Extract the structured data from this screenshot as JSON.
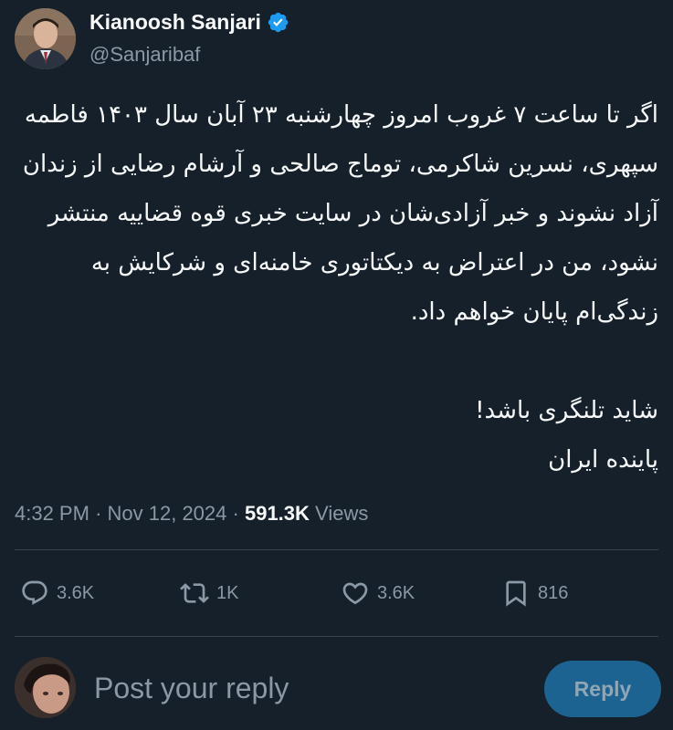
{
  "author": {
    "name": "Kianoosh Sanjari",
    "handle": "@Sanjaribaf"
  },
  "tweet": {
    "paragraph1": "اگر تا ساعت ۷ غروب امروز چهارشنبه ۲۳ آبان سال ۱۴۰۳ فاطمه سپهری، نسرین شاکرمی، توماج صالحی و آرشام رضایی از زندان آزاد نشوند و خبر آزادی‌شان در سایت خبری قوه قضاییه منتشر نشود، من در اعتراض به دیکتاتوری خامنه‌ای و شرکایش به زندگی‌ام پایان خواهم داد.",
    "line2": "شاید تلنگری باشد!",
    "line3": "پاینده ایران"
  },
  "meta": {
    "time": "4:32 PM",
    "separator1": "·",
    "date": "Nov 12, 2024",
    "separator2": "·",
    "views_count": "591.3K",
    "views_label": "Views"
  },
  "actions": {
    "replies": "3.6K",
    "reposts": "1K",
    "likes": "3.6K",
    "bookmarks": "816"
  },
  "composer": {
    "placeholder": "Post your reply",
    "button_label": "Reply"
  },
  "colors": {
    "background": "#15202b",
    "text": "#f7f9f9",
    "muted": "#8b98a5",
    "accent": "#1d9bf0",
    "reply_button_disabled": "#1d6391"
  },
  "icons": {
    "verified": "verified-badge-icon",
    "reply": "speech-bubble-icon",
    "repost": "repost-arrows-icon",
    "like": "heart-icon",
    "bookmark": "bookmark-icon"
  }
}
